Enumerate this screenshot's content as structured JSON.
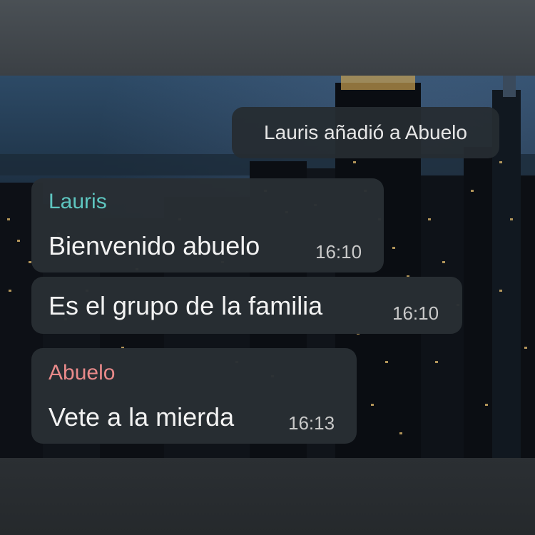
{
  "chat": {
    "system_message": "Lauris añadió a Abuelo",
    "messages": [
      {
        "sender": "Lauris",
        "text": "Bienvenido abuelo",
        "time": "16:10"
      },
      {
        "text": "Es el grupo de la familia",
        "time": "16:10"
      },
      {
        "sender": "Abuelo",
        "text": "Vete a la mierda",
        "time": "16:13"
      }
    ]
  },
  "colors": {
    "sender_lauris": "#5ec6c0",
    "sender_abuelo": "#e98a8a",
    "bubble_bg": "#282e34"
  }
}
